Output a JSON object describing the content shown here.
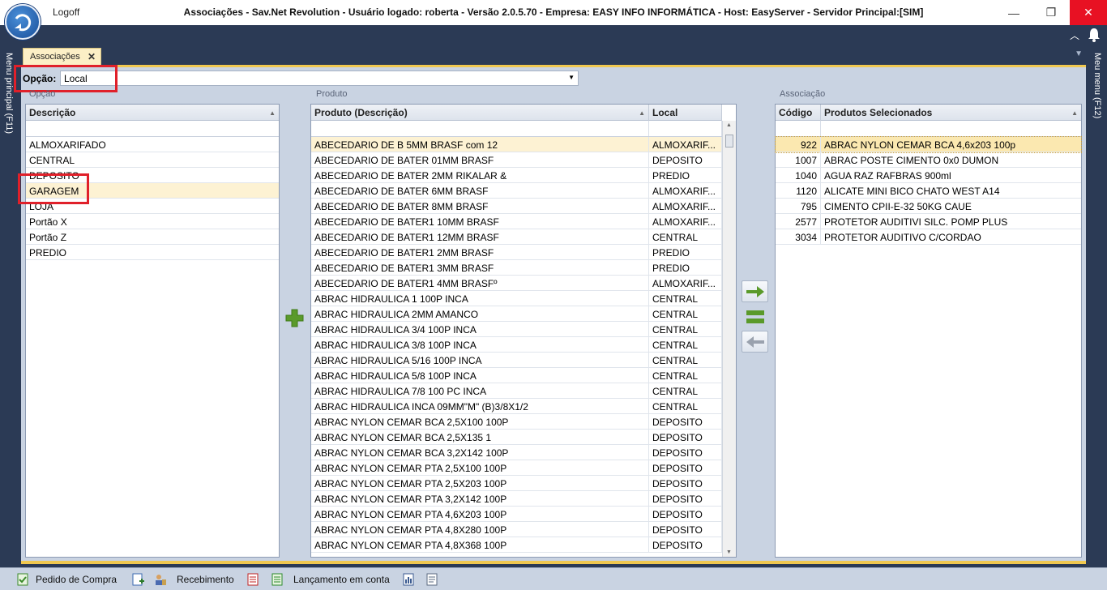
{
  "window": {
    "title": "Associações - Sav.Net Revolution - Usuário logado: roberta - Versão 2.0.5.70 - Empresa: EASY INFO INFORMÁTICA - Host: EasyServer - Servidor Principal:[SIM]",
    "logoff": "Logoff",
    "min": "—",
    "max": "❐",
    "close": "✕"
  },
  "side": {
    "left_label": "Menu principal (F11)",
    "right_label": "Meu menu (F12)"
  },
  "tab": {
    "label": "Associações",
    "close": "✕"
  },
  "opcao": {
    "label": "Opção:",
    "value": "Local"
  },
  "groups": {
    "opcao": "Opção",
    "produto": "Produto",
    "associacao": "Associação"
  },
  "opcao_grid": {
    "header": "Descrição",
    "rows": [
      "ALMOXARIFADO",
      "CENTRAL",
      "DEPOSITO",
      "GARAGEM",
      "LOJA",
      "Portão X",
      "Portão Z",
      "PREDIO"
    ],
    "selected_index": 3
  },
  "produto_grid": {
    "headers": [
      "Produto (Descrição)",
      "Local"
    ],
    "rows": [
      [
        "ABECEDARIO DE B 5MM BRASF com 12",
        "ALMOXARIF..."
      ],
      [
        "ABECEDARIO DE BATER 01MM BRASF",
        "DEPOSITO"
      ],
      [
        "ABECEDARIO DE BATER 2MM RIKALAR &",
        "PREDIO"
      ],
      [
        "ABECEDARIO DE BATER 6MM BRASF",
        "ALMOXARIF..."
      ],
      [
        "ABECEDARIO DE BATER 8MM BRASF",
        "ALMOXARIF..."
      ],
      [
        "ABECEDARIO DE BATER1 10MM BRASF",
        "ALMOXARIF..."
      ],
      [
        "ABECEDARIO DE BATER1 12MM BRASF",
        "CENTRAL"
      ],
      [
        "ABECEDARIO DE BATER1 2MM BRASF",
        "PREDIO"
      ],
      [
        "ABECEDARIO DE BATER1 3MM BRASF",
        "PREDIO"
      ],
      [
        "ABECEDARIO DE BATER1 4MM BRASFº",
        "ALMOXARIF..."
      ],
      [
        "ABRAC HIDRAULICA 1 100P INCA",
        "CENTRAL"
      ],
      [
        "ABRAC HIDRAULICA 2MM AMANCO",
        "CENTRAL"
      ],
      [
        "ABRAC HIDRAULICA 3/4 100P INCA",
        "CENTRAL"
      ],
      [
        "ABRAC HIDRAULICA 3/8 100P INCA",
        "CENTRAL"
      ],
      [
        "ABRAC HIDRAULICA 5/16 100P INCA",
        "CENTRAL"
      ],
      [
        "ABRAC HIDRAULICA 5/8 100P INCA",
        "CENTRAL"
      ],
      [
        "ABRAC HIDRAULICA 7/8 100 PC INCA",
        "CENTRAL"
      ],
      [
        "ABRAC HIDRAULICA INCA 09MM\"M\" (B)3/8X1/2",
        "CENTRAL"
      ],
      [
        "ABRAC NYLON CEMAR BCA 2,5X100 100P",
        "DEPOSITO"
      ],
      [
        "ABRAC NYLON CEMAR BCA 2,5X135 1",
        "DEPOSITO"
      ],
      [
        "ABRAC NYLON CEMAR BCA 3,2X142 100P",
        "DEPOSITO"
      ],
      [
        "ABRAC NYLON CEMAR PTA 2,5X100 100P",
        "DEPOSITO"
      ],
      [
        "ABRAC NYLON CEMAR PTA 2,5X203 100P",
        "DEPOSITO"
      ],
      [
        "ABRAC NYLON CEMAR PTA 3,2X142 100P",
        "DEPOSITO"
      ],
      [
        "ABRAC NYLON CEMAR PTA 4,6X203 100P",
        "DEPOSITO"
      ],
      [
        "ABRAC NYLON CEMAR PTA 4,8X280 100P",
        "DEPOSITO"
      ],
      [
        "ABRAC NYLON CEMAR PTA 4,8X368 100P",
        "DEPOSITO"
      ]
    ]
  },
  "associacao_grid": {
    "headers": [
      "Código",
      "Produtos Selecionados"
    ],
    "rows": [
      [
        "922",
        "ABRAC NYLON CEMAR BCA 4,6x203 100p"
      ],
      [
        "1007",
        "ABRAC POSTE CIMENTO  0x0 DUMON"
      ],
      [
        "1040",
        "AGUA RAZ RAFBRAS 900ml"
      ],
      [
        "1120",
        "ALICATE MINI BICO CHATO WEST A14"
      ],
      [
        "795",
        "CIMENTO CPII-E-32 50KG CAUE"
      ],
      [
        "2577",
        "PROTETOR AUDITIVI SILC. POMP PLUS"
      ],
      [
        "3034",
        "PROTETOR AUDITIVO C/CORDAO"
      ]
    ]
  },
  "taskbar": {
    "items": [
      "Pedido de Compra",
      "Recebimento",
      "Lançamento em conta"
    ]
  },
  "colors": {
    "accent": "#f0c850",
    "frame": "#2b3a55",
    "content": "#c9d3e2",
    "highlight": "#e0202a"
  }
}
